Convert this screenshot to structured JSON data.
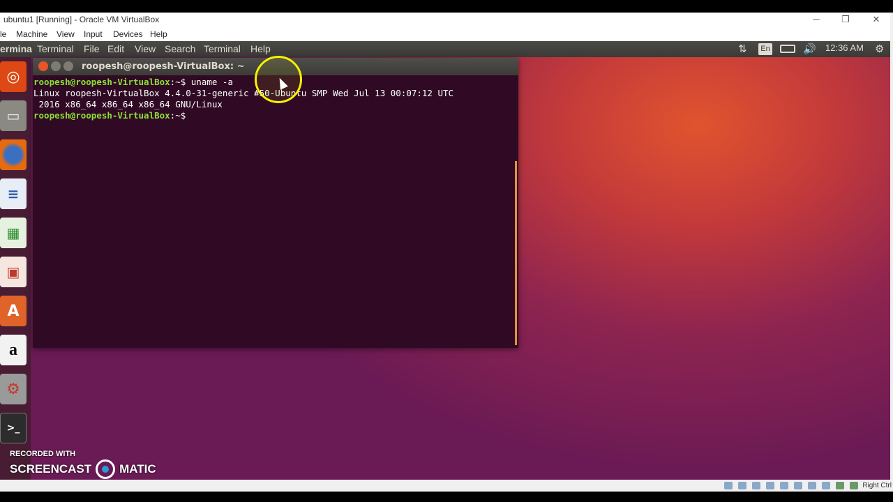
{
  "host": {
    "window_title": "ubuntu1 [Running] - Oracle VM VirtualBox",
    "menu": [
      "le",
      "Machine",
      "View",
      "Input",
      "Devices",
      "Help"
    ],
    "status_right": "Right Ctrl"
  },
  "panel": {
    "app_name": "ermina",
    "menus": [
      "Terminal",
      "File",
      "Edit",
      "View",
      "Search",
      "Terminal",
      "Help"
    ],
    "keyboard": "En",
    "time": "12:36 AM"
  },
  "launcher": {
    "items": [
      "ubuntu-dash-icon",
      "files-icon",
      "firefox-icon",
      "writer-icon",
      "calc-icon",
      "impress-icon",
      "software-center-icon",
      "amazon-icon",
      "settings-icon",
      "terminal-icon"
    ]
  },
  "terminal": {
    "title": "roopesh@roopesh-VirtualBox: ~",
    "prompt": "roopesh@roopesh-VirtualBox",
    "prompt_suffix": ":~$",
    "command": " uname -a",
    "output_line1": "Linux roopesh-VirtualBox 4.4.0-31-generic #50-Ubuntu SMP Wed Jul 13 00:07:12 UTC",
    "output_line2": " 2016 x86_64 x86_64 x86_64 GNU/Linux"
  },
  "watermark": {
    "line1": "RECORDED WITH",
    "left": "SCREENCAST",
    "right": "MATIC"
  },
  "colors": {
    "terminal_bg": "#300a24",
    "prompt": "#8ae234",
    "desktop_orange": "#e0542e",
    "desktop_purple": "#6a1a55"
  }
}
